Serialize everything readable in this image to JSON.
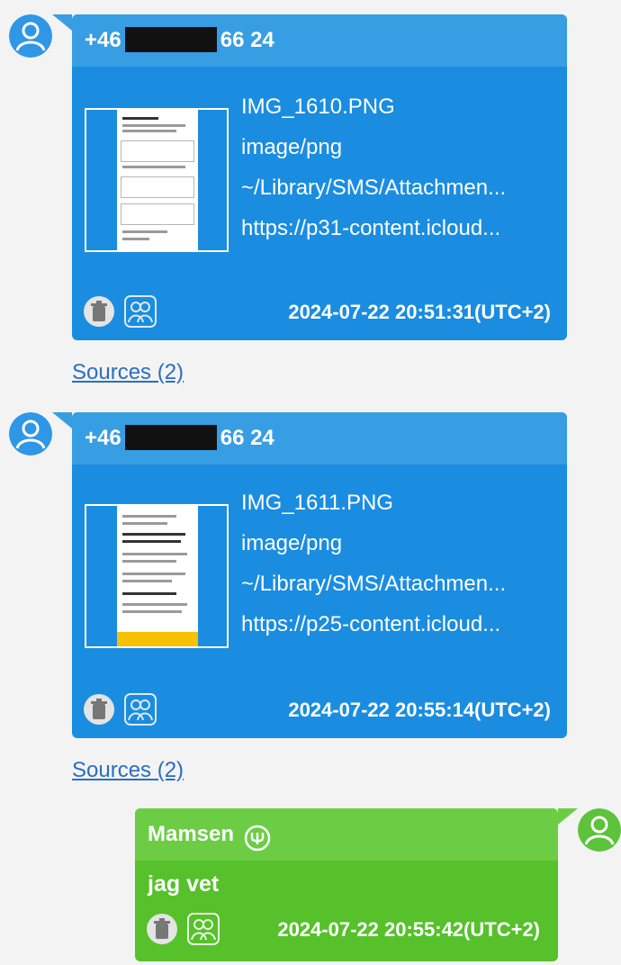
{
  "messages": [
    {
      "sender": "+46",
      "sender_suffix": "66 24",
      "attachment": {
        "filename": "IMG_1610.PNG",
        "mime": "image/png",
        "path": "~/Library/SMS/Attachmen...",
        "url": "https://p31-content.icloud..."
      },
      "timestamp": "2024-07-22 20:51:31(UTC+2)",
      "sources": "Sources (2)"
    },
    {
      "sender": "+46",
      "sender_suffix": "66 24",
      "attachment": {
        "filename": "IMG_1611.PNG",
        "mime": "image/png",
        "path": "~/Library/SMS/Attachmen...",
        "url": "https://p25-content.icloud..."
      },
      "timestamp": "2024-07-22 20:55:14(UTC+2)",
      "sources": "Sources (2)"
    },
    {
      "sender": "Mamsen",
      "body": "jag vet",
      "timestamp": "2024-07-22 20:55:42(UTC+2)"
    }
  ],
  "icons": {
    "avatar": "user-icon",
    "delete": "trash-icon",
    "participants": "group-icon",
    "sender_badge": "emoji-icon"
  },
  "colors": {
    "incoming_bubble": "#1a8de0",
    "incoming_header": "#389ee3",
    "outgoing_bubble": "#56c12b",
    "outgoing_header": "#6ccd45",
    "link": "#2a6ec2",
    "avatar": "#2f97e6"
  }
}
